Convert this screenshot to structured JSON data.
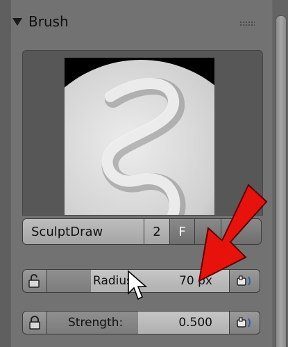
{
  "panel": {
    "title": "Brush"
  },
  "brush": {
    "name": "SculptDraw",
    "users": "2",
    "fake_user_label": "F"
  },
  "sliders": {
    "radius": {
      "label": "Radius:",
      "value": "70 px",
      "fill_fraction": 0.24
    },
    "strength": {
      "label": "Strength:",
      "value": "0.500",
      "fill_fraction": 0.5
    }
  },
  "colors": {
    "annotation_arrow": "#e8120c"
  },
  "icons": [
    "collapse-triangle-icon",
    "drag-grip-icon",
    "lock-icon",
    "pen-pressure-icon",
    "mouse-cursor-icon",
    "annotation-arrow-icon"
  ]
}
